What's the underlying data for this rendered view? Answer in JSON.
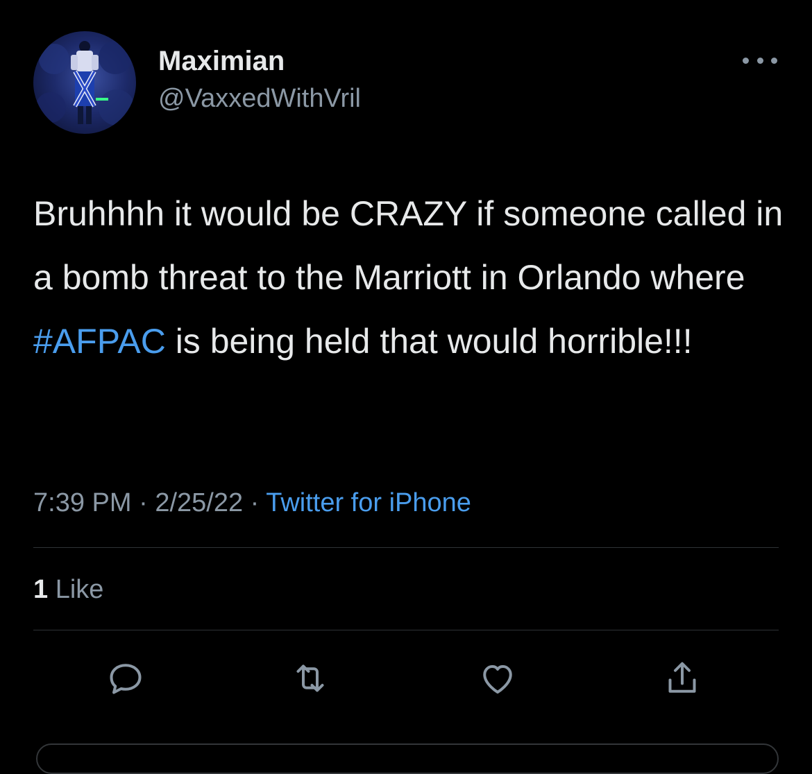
{
  "user": {
    "display_name": "Maximian",
    "handle": "@VaxxedWithVril",
    "avatar": "user-avatar"
  },
  "more_icon": "more-horizontal-icon",
  "tweet": {
    "text_before": "Bruhhhh it would be CRAZY if someone called in a bomb threat to the Marriott in Orlando where ",
    "hashtag": "#AFPAC",
    "text_after": " is being held that would horrible!!!"
  },
  "meta": {
    "time": "7:39 PM",
    "separator": "·",
    "date": "2/25/22",
    "source": "Twitter for iPhone"
  },
  "stats": {
    "like_count": "1",
    "like_label": "Like"
  },
  "actions": [
    {
      "icon": "reply-icon"
    },
    {
      "icon": "retweet-icon"
    },
    {
      "icon": "like-icon"
    },
    {
      "icon": "share-icon"
    }
  ],
  "colors": {
    "background": "#000000",
    "text": "#e7e9ea",
    "secondary": "#8b98a5",
    "link": "#4a9ded",
    "divider": "#2f3336"
  }
}
